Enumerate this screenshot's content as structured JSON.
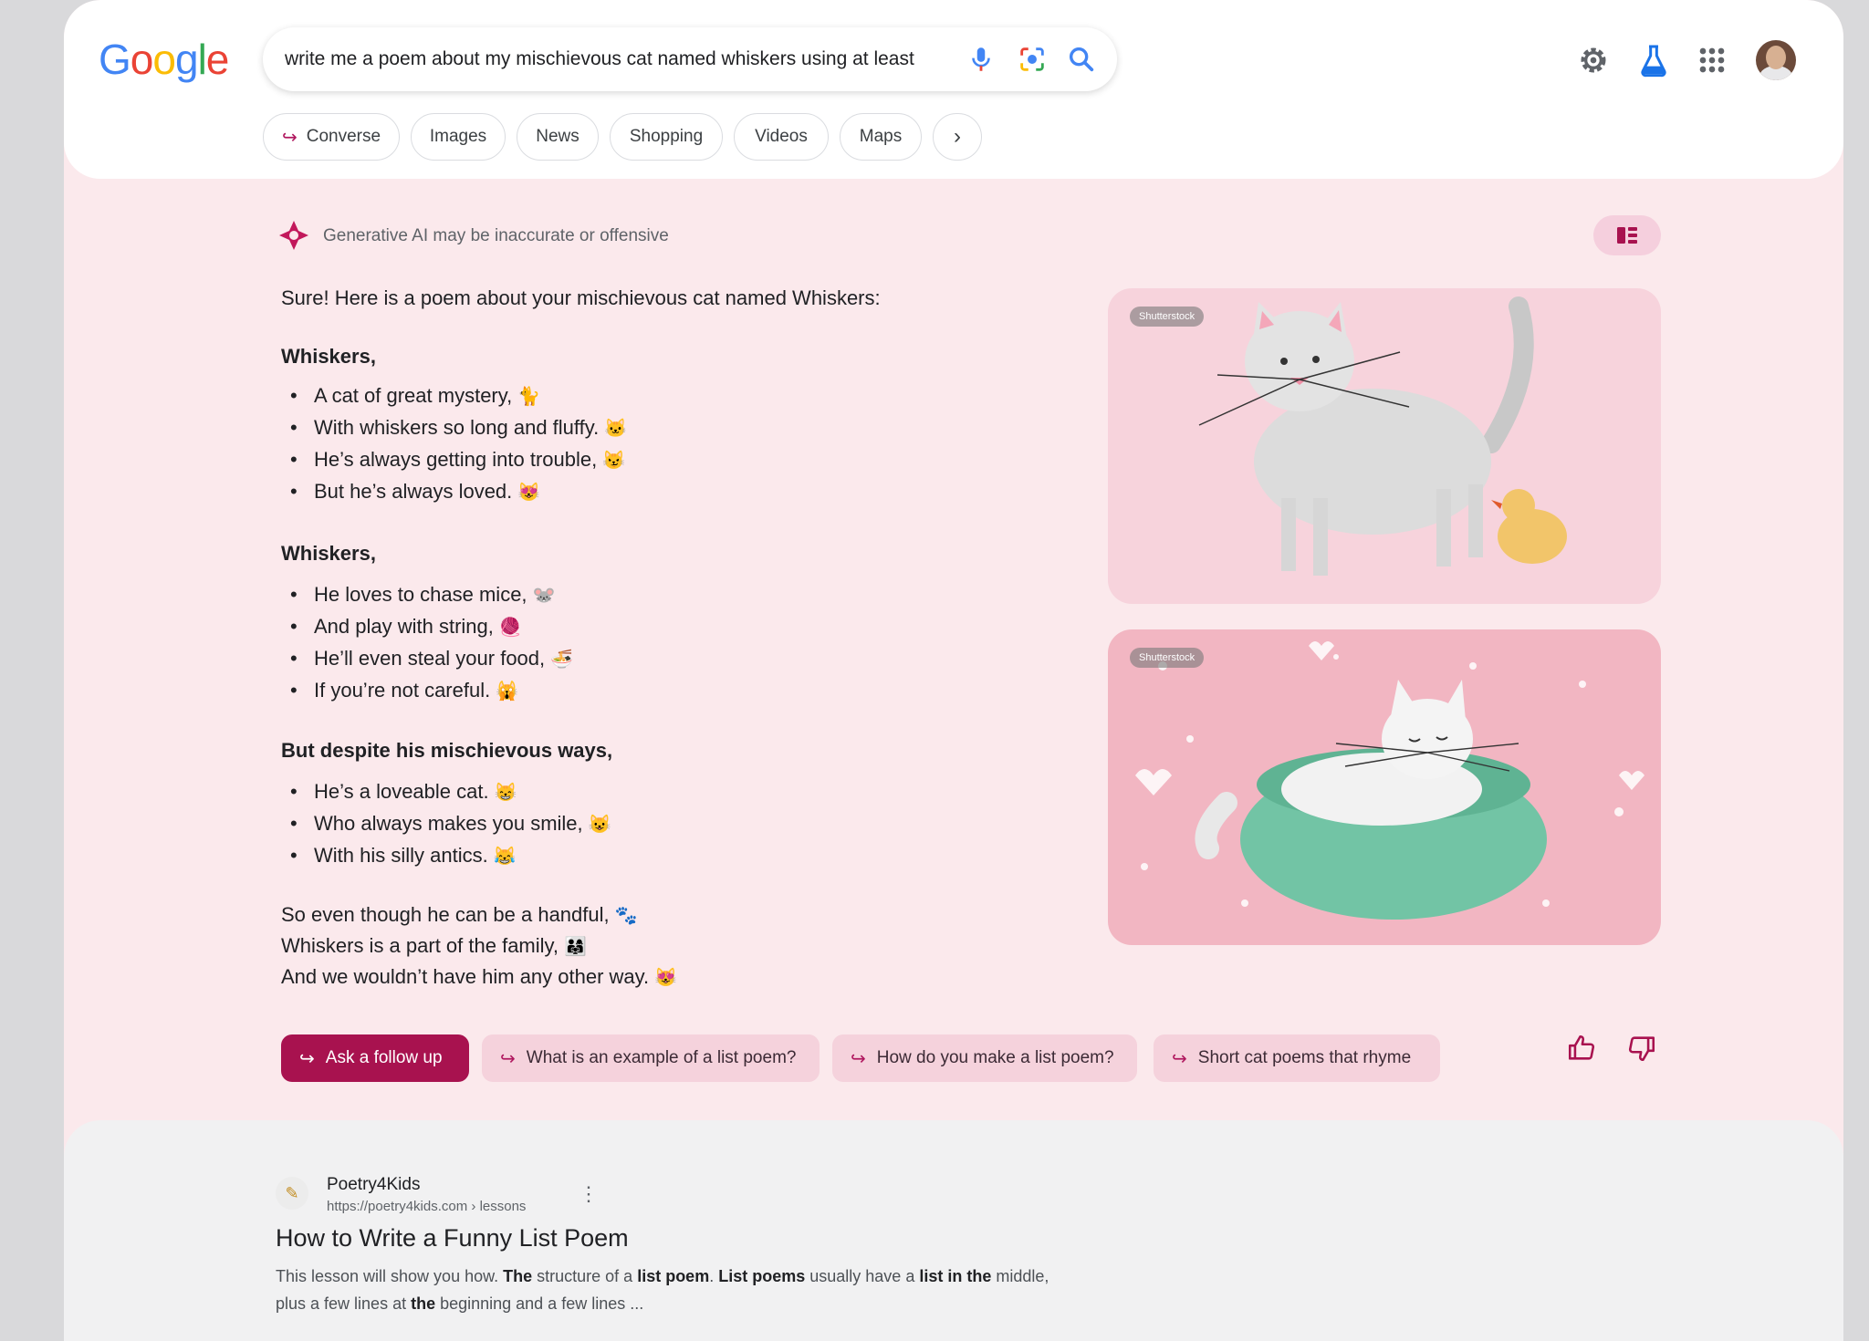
{
  "header": {
    "logo_letters": [
      {
        "ch": "G",
        "color": "#4285F4"
      },
      {
        "ch": "o",
        "color": "#EA4335"
      },
      {
        "ch": "o",
        "color": "#FBBC05"
      },
      {
        "ch": "g",
        "color": "#4285F4"
      },
      {
        "ch": "l",
        "color": "#34A853"
      },
      {
        "ch": "e",
        "color": "#EA4335"
      }
    ],
    "search_query": "write me a poem about my mischievous cat named whiskers using at least",
    "icons": [
      "mic-icon",
      "lens-icon",
      "search-icon",
      "settings-icon",
      "labs-flask-icon",
      "apps-grid-icon",
      "avatar"
    ]
  },
  "chips": [
    {
      "label": "Converse",
      "arrow": "↪"
    },
    {
      "label": "Images"
    },
    {
      "label": "News"
    },
    {
      "label": "Shopping"
    },
    {
      "label": "Videos"
    },
    {
      "label": "Maps"
    }
  ],
  "ai": {
    "notice": "Generative AI may be inaccurate or offensive",
    "intro": "Sure! Here is a poem about your mischievous cat named Whiskers:",
    "stanzas": [
      {
        "heading": "Whiskers,",
        "lines": [
          {
            "text": "A cat of great mystery,",
            "emoji": "🐈"
          },
          {
            "text": "With whiskers so long and fluffy.",
            "emoji": "🐱"
          },
          {
            "text": "He’s always getting into trouble,",
            "emoji": "😼"
          },
          {
            "text": "But he’s always loved.",
            "emoji": "😻"
          }
        ]
      },
      {
        "heading": "Whiskers,",
        "lines": [
          {
            "text": "He loves to chase mice,",
            "emoji": "🐭"
          },
          {
            "text": "And play with string,",
            "emoji": "🧶"
          },
          {
            "text": "He’ll even steal your food,",
            "emoji": "🍜"
          },
          {
            "text": "If you’re not careful.",
            "emoji": "🙀"
          }
        ]
      },
      {
        "heading": "But despite his mischievous ways,",
        "lines": [
          {
            "text": "He’s a loveable cat.",
            "emoji": "😸"
          },
          {
            "text": "Who always makes you smile,",
            "emoji": "😺"
          },
          {
            "text": "With his silly antics.",
            "emoji": "😹"
          }
        ]
      }
    ],
    "closing": [
      {
        "text": "So even though he can be a handful,",
        "emoji": "🐾"
      },
      {
        "text": "Whiskers is a part of the family,",
        "emoji": "👨‍👩‍👧"
      },
      {
        "text": "And we wouldn’t have him any other way.",
        "emoji": "😻"
      }
    ],
    "images": [
      {
        "badge": "Shutterstock",
        "alt": "cat-with-rubber-duck"
      },
      {
        "badge": "Shutterstock",
        "alt": "cat-in-green-bed"
      }
    ],
    "followups": [
      {
        "label": "Ask a follow up",
        "primary": true
      },
      {
        "label": "What is an example of a list poem?"
      },
      {
        "label": "How do you make a list poem?"
      },
      {
        "label": "Short cat poems that rhyme"
      }
    ]
  },
  "result": {
    "site_name": "Poetry4Kids",
    "site_url": "https://poetry4kids.com › lessons",
    "title": "How to Write a Funny List Poem",
    "snippet_parts": [
      {
        "t": "This lesson will show you how. ",
        "b": false
      },
      {
        "t": "The",
        "b": true
      },
      {
        "t": " structure of a ",
        "b": false
      },
      {
        "t": "list poem",
        "b": true
      },
      {
        "t": ". ",
        "b": false
      },
      {
        "t": "List poems",
        "b": true
      },
      {
        "t": " usually have a ",
        "b": false
      },
      {
        "t": "list in the",
        "b": true
      },
      {
        "t": " middle, plus a few lines at ",
        "b": false
      },
      {
        "t": "the",
        "b": true
      },
      {
        "t": " beginning and a few lines ...",
        "b": false
      }
    ]
  },
  "colors": {
    "accent": "#a8124f",
    "ai_background": "#fbe9ec",
    "chip_pink": "#f5d2dc"
  }
}
